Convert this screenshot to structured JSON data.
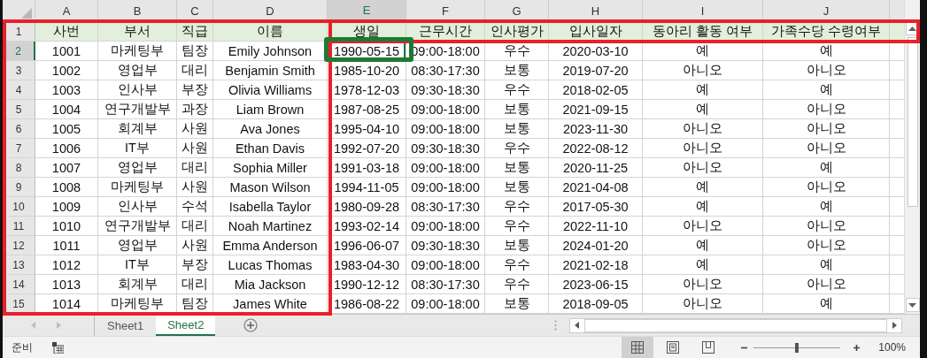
{
  "columns": [
    {
      "letter": "A",
      "selected": false
    },
    {
      "letter": "B",
      "selected": false
    },
    {
      "letter": "C",
      "selected": false
    },
    {
      "letter": "D",
      "selected": false
    },
    {
      "letter": "E",
      "selected": true
    },
    {
      "letter": "F",
      "selected": false
    },
    {
      "letter": "G",
      "selected": false
    },
    {
      "letter": "H",
      "selected": false
    },
    {
      "letter": "I",
      "selected": false
    },
    {
      "letter": "J",
      "selected": false
    }
  ],
  "rows": [
    {
      "number": "1",
      "kind": "header",
      "selected": false,
      "cells": [
        "사번",
        "부서",
        "직급",
        "이름",
        "생일",
        "근무시간",
        "인사평가",
        "입사일자",
        "동아리 활동 여부",
        "가족수당 수령여부"
      ]
    },
    {
      "number": "2",
      "kind": "data",
      "selected": true,
      "cells": [
        "1001",
        "마케팅부",
        "팀장",
        "Emily Johnson",
        "1990-05-15",
        "09:00-18:00",
        "우수",
        "2020-03-10",
        "예",
        "예"
      ]
    },
    {
      "number": "3",
      "kind": "data",
      "selected": false,
      "cells": [
        "1002",
        "영업부",
        "대리",
        "Benjamin Smith",
        "1985-10-20",
        "08:30-17:30",
        "보통",
        "2019-07-20",
        "아니오",
        "아니오"
      ]
    },
    {
      "number": "4",
      "kind": "data",
      "selected": false,
      "cells": [
        "1003",
        "인사부",
        "부장",
        "Olivia Williams",
        "1978-12-03",
        "09:30-18:30",
        "우수",
        "2018-02-05",
        "예",
        "예"
      ]
    },
    {
      "number": "5",
      "kind": "data",
      "selected": false,
      "cells": [
        "1004",
        "연구개발부",
        "과장",
        "Liam Brown",
        "1987-08-25",
        "09:00-18:00",
        "보통",
        "2021-09-15",
        "예",
        "아니오"
      ]
    },
    {
      "number": "6",
      "kind": "data",
      "selected": false,
      "cells": [
        "1005",
        "회계부",
        "사원",
        "Ava Jones",
        "1995-04-10",
        "09:00-18:00",
        "보통",
        "2023-11-30",
        "아니오",
        "아니오"
      ]
    },
    {
      "number": "7",
      "kind": "data",
      "selected": false,
      "cells": [
        "1006",
        "IT부",
        "사원",
        "Ethan Davis",
        "1992-07-20",
        "09:30-18:30",
        "우수",
        "2022-08-12",
        "아니오",
        "아니오"
      ]
    },
    {
      "number": "8",
      "kind": "data",
      "selected": false,
      "cells": [
        "1007",
        "영업부",
        "대리",
        "Sophia Miller",
        "1991-03-18",
        "09:00-18:00",
        "보통",
        "2020-11-25",
        "아니오",
        "예"
      ]
    },
    {
      "number": "9",
      "kind": "data",
      "selected": false,
      "cells": [
        "1008",
        "마케팅부",
        "사원",
        "Mason Wilson",
        "1994-11-05",
        "09:00-18:00",
        "보통",
        "2021-04-08",
        "예",
        "아니오"
      ]
    },
    {
      "number": "10",
      "kind": "data",
      "selected": false,
      "cells": [
        "1009",
        "인사부",
        "수석",
        "Isabella Taylor",
        "1980-09-28",
        "08:30-17:30",
        "우수",
        "2017-05-30",
        "예",
        "예"
      ]
    },
    {
      "number": "11",
      "kind": "data",
      "selected": false,
      "cells": [
        "1010",
        "연구개발부",
        "대리",
        "Noah Martinez",
        "1993-02-14",
        "09:00-18:00",
        "우수",
        "2022-11-10",
        "아니오",
        "아니오"
      ]
    },
    {
      "number": "12",
      "kind": "data",
      "selected": false,
      "cells": [
        "1011",
        "영업부",
        "사원",
        "Emma Anderson",
        "1996-06-07",
        "09:30-18:30",
        "보통",
        "2024-01-20",
        "예",
        "아니오"
      ]
    },
    {
      "number": "13",
      "kind": "data",
      "selected": false,
      "cells": [
        "1012",
        "IT부",
        "부장",
        "Lucas Thomas",
        "1983-04-30",
        "09:00-18:00",
        "우수",
        "2021-02-18",
        "예",
        "예"
      ]
    },
    {
      "number": "14",
      "kind": "data",
      "selected": false,
      "cells": [
        "1013",
        "회계부",
        "대리",
        "Mia Jackson",
        "1990-12-12",
        "08:30-17:30",
        "우수",
        "2023-06-15",
        "아니오",
        "아니오"
      ]
    },
    {
      "number": "15",
      "kind": "data",
      "selected": false,
      "cells": [
        "1014",
        "마케팅부",
        "팀장",
        "James White",
        "1986-08-22",
        "09:00-18:00",
        "보통",
        "2018-09-05",
        "아니오",
        "예"
      ]
    }
  ],
  "sheet_tabs": [
    {
      "label": "Sheet1",
      "selected": false
    },
    {
      "label": "Sheet2",
      "selected": true
    }
  ],
  "status_bar": {
    "text": "준비",
    "views": [
      {
        "kind": "normal",
        "selected": true
      },
      {
        "kind": "page_layout",
        "selected": false
      },
      {
        "kind": "page_break",
        "selected": false
      }
    ],
    "zoom": {
      "level": 0.5,
      "reading": "100%"
    }
  }
}
